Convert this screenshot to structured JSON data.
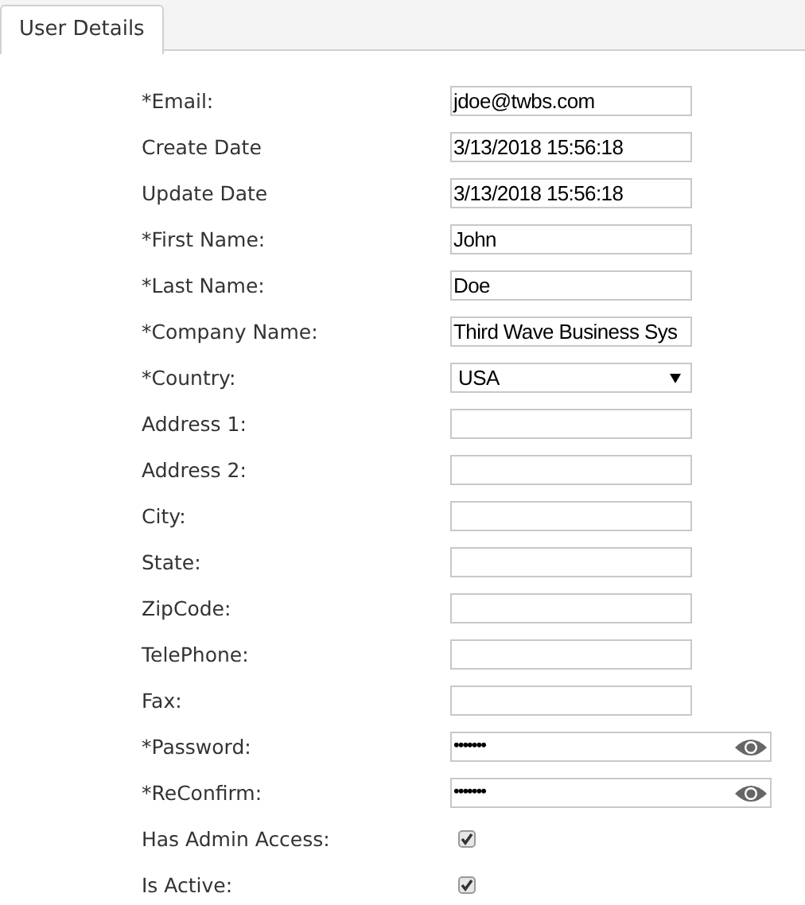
{
  "tabs": [
    {
      "label": "User Details",
      "selected": true
    }
  ],
  "fields": [
    {
      "label": "*Email:",
      "kind": "text",
      "value": "jdoe@twbs.com"
    },
    {
      "label": "Create Date",
      "kind": "text",
      "value": "3/13/2018 15:56:18"
    },
    {
      "label": "Update Date",
      "kind": "text",
      "value": "3/13/2018 15:56:18"
    },
    {
      "label": "*First Name:",
      "kind": "text",
      "value": "John"
    },
    {
      "label": "*Last Name:",
      "kind": "text",
      "value": "Doe"
    },
    {
      "label": "*Company Name:",
      "kind": "text",
      "value": "Third Wave Business Sys"
    },
    {
      "label": "*Country:",
      "kind": "select",
      "value": "USA"
    },
    {
      "label": "Address 1:",
      "kind": "text"
    },
    {
      "label": "Address 2:",
      "kind": "text"
    },
    {
      "label": "City:",
      "kind": "text"
    },
    {
      "label": "State:",
      "kind": "text"
    },
    {
      "label": "ZipCode:",
      "kind": "text"
    },
    {
      "label": "TelePhone:",
      "kind": "text"
    },
    {
      "label": "Fax:",
      "kind": "text"
    },
    {
      "label": "*Password:",
      "kind": "password",
      "value": "•••••••"
    },
    {
      "label": "*ReConfirm:",
      "kind": "password",
      "value": "•••••••"
    },
    {
      "label": "Has Admin Access:",
      "kind": "checkbox",
      "checked": true
    },
    {
      "label": "Is Active:",
      "kind": "checkbox",
      "checked": true
    }
  ]
}
